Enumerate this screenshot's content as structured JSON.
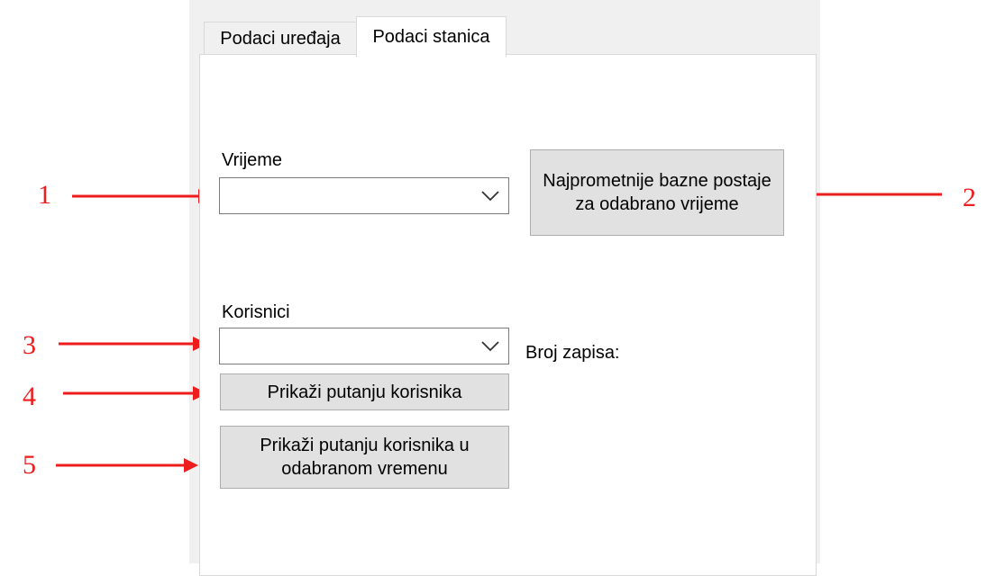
{
  "tabs": [
    {
      "label": "Podaci uređaja"
    },
    {
      "label": "Podaci stanica"
    }
  ],
  "time_section": {
    "label": "Vrijeme",
    "combo_value": "",
    "button_label": "Najprometnije bazne postaje za odabrano vrijeme"
  },
  "users_section": {
    "label": "Korisnici",
    "combo_value": "",
    "record_count_label": "Broj zapisa:",
    "show_path_button": "Prikaži putanju korisnika",
    "show_path_time_button": "Prikaži putanju korisnika u odabranom vremenu"
  },
  "annotations": {
    "numbers": [
      "1",
      "2",
      "3",
      "4",
      "5"
    ],
    "color": "#ee1c1c"
  }
}
